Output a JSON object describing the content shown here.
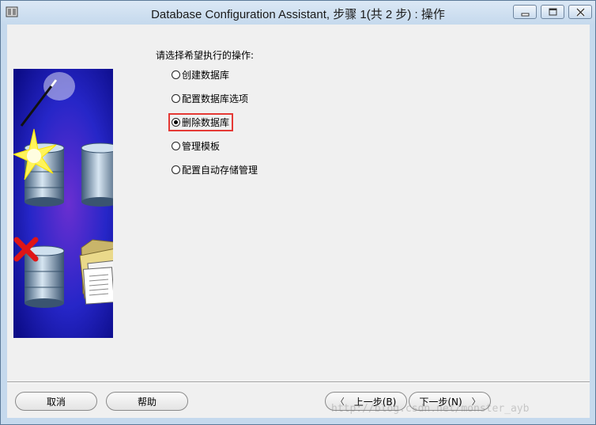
{
  "window": {
    "title": "Database Configuration Assistant, 步骤 1(共 2 步) : 操作"
  },
  "main": {
    "prompt": "请选择希望执行的操作:",
    "options": [
      {
        "label": "创建数据库",
        "selected": false
      },
      {
        "label": "配置数据库选项",
        "selected": false
      },
      {
        "label": "删除数据库",
        "selected": true
      },
      {
        "label": "管理模板",
        "selected": false
      },
      {
        "label": "配置自动存储管理",
        "selected": false
      }
    ]
  },
  "footer": {
    "cancel_label": "取消",
    "help_label": "帮助",
    "back_label": "上一步(B)",
    "next_label": "下一步(N)"
  },
  "watermark": "http://blog.csdn.net/monster_ayb",
  "colors": {
    "highlight_border": "#e53935",
    "image_background": "#1c1cb0"
  }
}
